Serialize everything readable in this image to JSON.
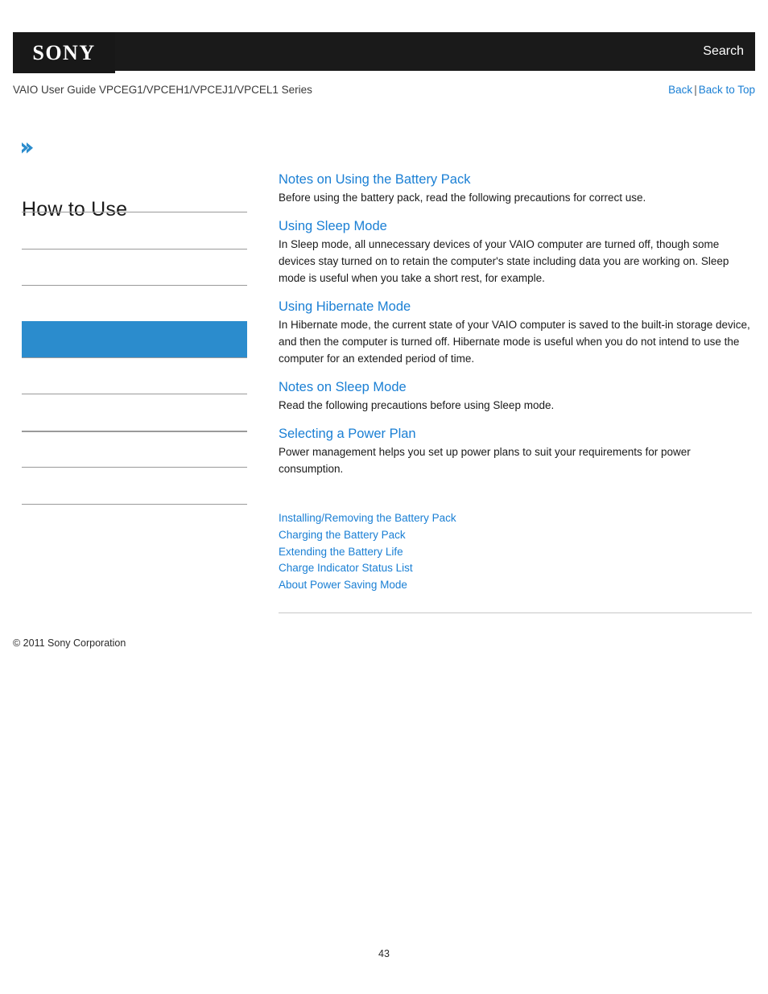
{
  "header": {
    "logo": "SONY",
    "search_label": "Search",
    "guide_title": "VAIO User Guide VPCEG1/VPCEH1/VPCEJ1/VPCEL1 Series",
    "back_label": "Back",
    "separator": "|",
    "back_to_top_label": "Back to Top"
  },
  "sidebar": {
    "expand_icon": "chevron-right-icon",
    "heading": "How to Use",
    "items": [
      {
        "label": "",
        "selected": false,
        "thick": false
      },
      {
        "label": "",
        "selected": false,
        "thick": false
      },
      {
        "label": "",
        "selected": false,
        "thick": false
      },
      {
        "label": "",
        "selected": true,
        "thick": false
      },
      {
        "label": "",
        "selected": false,
        "thick": false
      },
      {
        "label": "",
        "selected": false,
        "thick": false
      },
      {
        "label": "",
        "selected": false,
        "thick": true
      },
      {
        "label": "",
        "selected": false,
        "thick": false
      }
    ]
  },
  "main": {
    "sections": [
      {
        "title": "Notes on Using the Battery Pack",
        "body": "Before using the battery pack, read the following precautions for correct use."
      },
      {
        "title": "Using Sleep Mode",
        "body": "In Sleep mode, all unnecessary devices of your VAIO computer are turned off, though some devices stay turned on to retain the computer's state including data you are working on. Sleep mode is useful when you take a short rest, for example."
      },
      {
        "title": "Using Hibernate Mode",
        "body": "In Hibernate mode, the current state of your VAIO computer is saved to the built-in storage device, and then the computer is turned off. Hibernate mode is useful when you do not intend to use the computer for an extended period of time."
      },
      {
        "title": "Notes on Sleep Mode",
        "body": "Read the following precautions before using Sleep mode."
      },
      {
        "title": "Selecting a Power Plan",
        "body": "Power management helps you set up power plans to suit your requirements for power consumption."
      }
    ],
    "related_links": [
      "Installing/Removing the Battery Pack",
      "Charging the Battery Pack",
      "Extending the Battery Life",
      "Charge Indicator Status List",
      "About Power Saving Mode"
    ]
  },
  "footer": {
    "copyright": "© 2011 Sony Corporation",
    "page_number": "43"
  },
  "colors": {
    "link_blue": "#1a7fd4",
    "selected_blue": "#2b8ccd",
    "header_black": "#1a1a1a",
    "rule_gray": "#9a9a9a"
  }
}
